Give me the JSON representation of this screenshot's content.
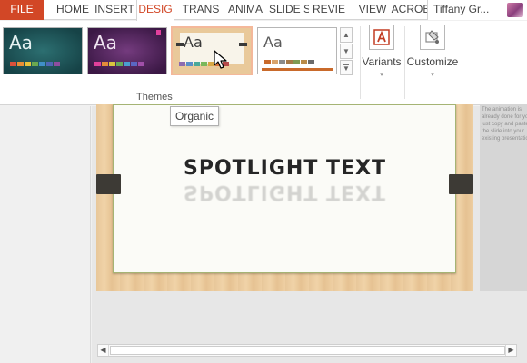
{
  "tabs": [
    {
      "label": "FILE",
      "state": "file"
    },
    {
      "label": "HOME",
      "state": "normal"
    },
    {
      "label": "INSERT",
      "state": "normal"
    },
    {
      "label": "DESIG",
      "state": "active"
    },
    {
      "label": "TRANS",
      "state": "normal"
    },
    {
      "label": "ANIMA",
      "state": "normal"
    },
    {
      "label": "SLIDE S",
      "state": "normal"
    },
    {
      "label": "REVIE",
      "state": "normal"
    },
    {
      "label": "VIEW",
      "state": "normal"
    },
    {
      "label": "ACROB",
      "state": "normal"
    }
  ],
  "user": {
    "name": "Tiffany Gr..."
  },
  "ribbon": {
    "themes_group_label": "Themes",
    "themes": [
      {
        "aa": "Aa",
        "swatches": [
          "#d9513b",
          "#e88e35",
          "#e7c23a",
          "#6aa84f",
          "#3f8fc6",
          "#4e66b3",
          "#8d4d9f"
        ]
      },
      {
        "aa": "Aa",
        "swatches": [
          "#e0409b",
          "#e58b3a",
          "#d9c43e",
          "#67a85a",
          "#4a9ed0",
          "#5a67c2",
          "#a04fa8"
        ]
      },
      {
        "aa": "Aa",
        "swatches": [
          "#8c6bb0",
          "#5a8fc9",
          "#4aa99a",
          "#7ab85b",
          "#d8a845",
          "#d4713a",
          "#b64a4a"
        ]
      },
      {
        "aa": "Aa",
        "swatches": [
          "#c96a2b",
          "#d9a36b",
          "#8b8b8b",
          "#a57948",
          "#7f9a52",
          "#b98b48",
          "#6a6a6a"
        ]
      }
    ],
    "variants_label": "Variants",
    "customize_label": "Customize"
  },
  "slide": {
    "text": "SPOTLIGHT TEXT"
  },
  "next_slide": {
    "note": "The animation is already done for you; just copy and paste the slide into your existing presentation."
  },
  "tooltip": {
    "text": "Organic"
  },
  "icons": {
    "scroll_up": "▲",
    "scroll_down": "▼",
    "scroll_more": "▼",
    "caret": "▾",
    "arrow_left": "◀",
    "arrow_right": "▶"
  },
  "colors": {
    "file_tab": "#d24726",
    "active_tab_text": "#d24726",
    "theme_selected_border": "#f4b89a"
  }
}
